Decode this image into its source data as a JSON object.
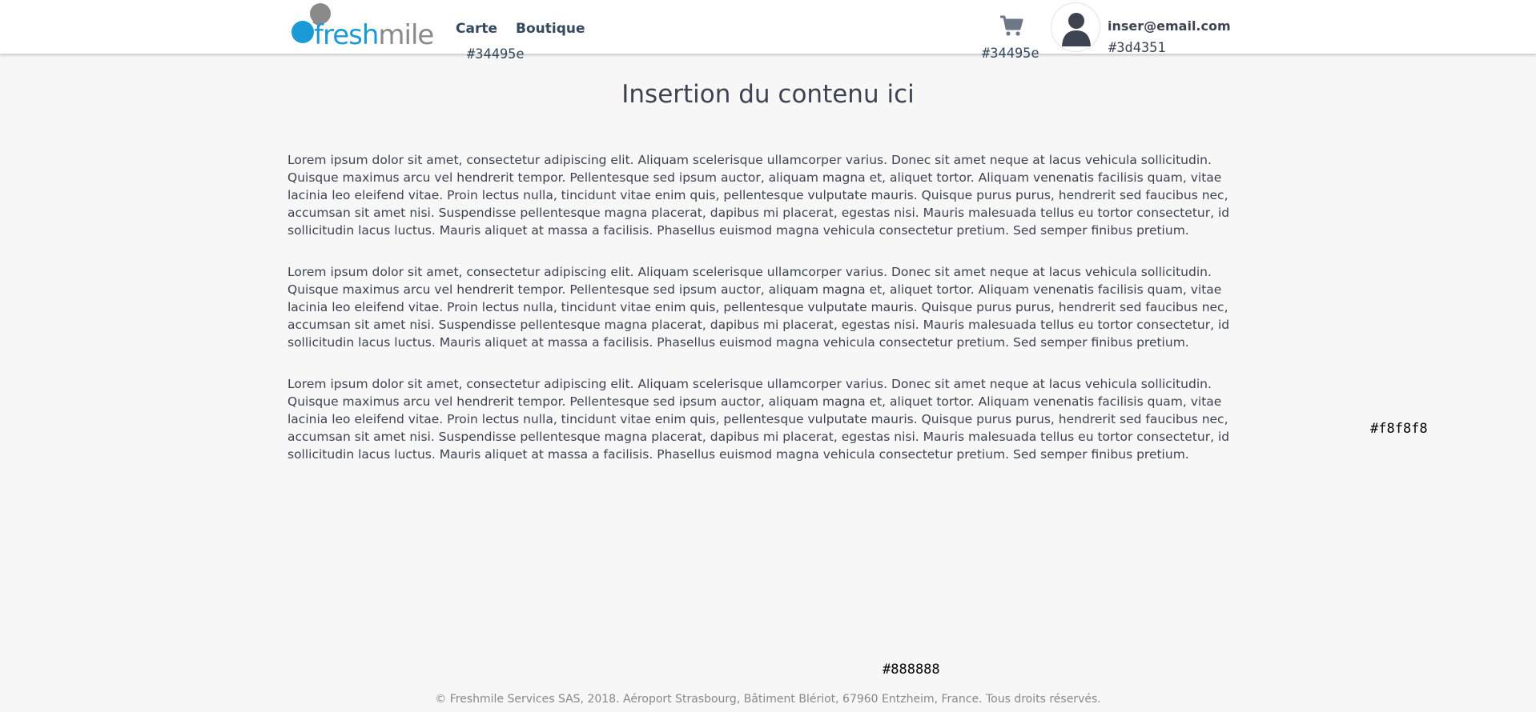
{
  "brand": {
    "logo_text_part1": "fresh",
    "logo_text_part2": "mile",
    "accent_color": "#1a9ad6",
    "logo_grey": "#8a8a8a"
  },
  "nav": {
    "items": [
      {
        "label": "Carte"
      },
      {
        "label": "Boutique"
      }
    ]
  },
  "annotations": {
    "nav_color": "#34495e",
    "cart_color": "#34495e",
    "user_color": "#3d4351",
    "background_color": "#f8f8f8",
    "footer_color": "#888888"
  },
  "user": {
    "email": "inser@email.com",
    "avatar_icon": "user-silhouette-icon"
  },
  "cart": {
    "icon": "shopping-cart-icon"
  },
  "main": {
    "title": "Insertion du contenu ici",
    "paragraphs": [
      "Lorem ipsum dolor sit amet, consectetur adipiscing elit. Aliquam scelerisque ullamcorper varius. Donec sit amet neque at lacus vehicula sollicitudin. Quisque maximus arcu vel hendrerit tempor. Pellentesque sed ipsum auctor, aliquam magna et, aliquet tortor. Aliquam venenatis facilisis quam, vitae lacinia leo eleifend vitae. Proin lectus nulla, tincidunt vitae enim quis, pellentesque vulputate mauris. Quisque purus purus, hendrerit sed faucibus nec, accumsan sit amet nisi. Suspendisse pellentesque magna placerat, dapibus mi placerat, egestas nisi. Mauris malesuada tellus eu tortor consectetur, id sollicitudin lacus luctus. Mauris aliquet at massa a facilisis. Phasellus euismod magna vehicula consectetur pretium. Sed semper finibus pretium.",
      "Lorem ipsum dolor sit amet, consectetur adipiscing elit. Aliquam scelerisque ullamcorper varius. Donec sit amet neque at lacus vehicula sollicitudin. Quisque maximus arcu vel hendrerit tempor. Pellentesque sed ipsum auctor, aliquam magna et, aliquet tortor. Aliquam venenatis facilisis quam, vitae lacinia leo eleifend vitae. Proin lectus nulla, tincidunt vitae enim quis, pellentesque vulputate mauris. Quisque purus purus, hendrerit sed faucibus nec, accumsan sit amet nisi. Suspendisse pellentesque magna placerat, dapibus mi placerat, egestas nisi. Mauris malesuada tellus eu tortor consectetur, id sollicitudin lacus luctus. Mauris aliquet at massa a facilisis. Phasellus euismod magna vehicula consectetur pretium. Sed semper finibus pretium.",
      "Lorem ipsum dolor sit amet, consectetur adipiscing elit. Aliquam scelerisque ullamcorper varius. Donec sit amet neque at lacus vehicula sollicitudin. Quisque maximus arcu vel hendrerit tempor. Pellentesque sed ipsum auctor, aliquam magna et, aliquet tortor. Aliquam venenatis facilisis quam, vitae lacinia leo eleifend vitae. Proin lectus nulla, tincidunt vitae enim quis, pellentesque vulputate mauris. Quisque purus purus, hendrerit sed faucibus nec, accumsan sit amet nisi. Suspendisse pellentesque magna placerat, dapibus mi placerat, egestas nisi. Mauris malesuada tellus eu tortor consectetur, id sollicitudin lacus luctus. Mauris aliquet at massa a facilisis. Phasellus euismod magna vehicula consectetur pretium. Sed semper finibus pretium."
    ]
  },
  "footer": {
    "text": "© Freshmile Services SAS, 2018. Aéroport Strasbourg, Bâtiment Blériot, 67960 Entzheim, France. Tous droits réservés."
  }
}
